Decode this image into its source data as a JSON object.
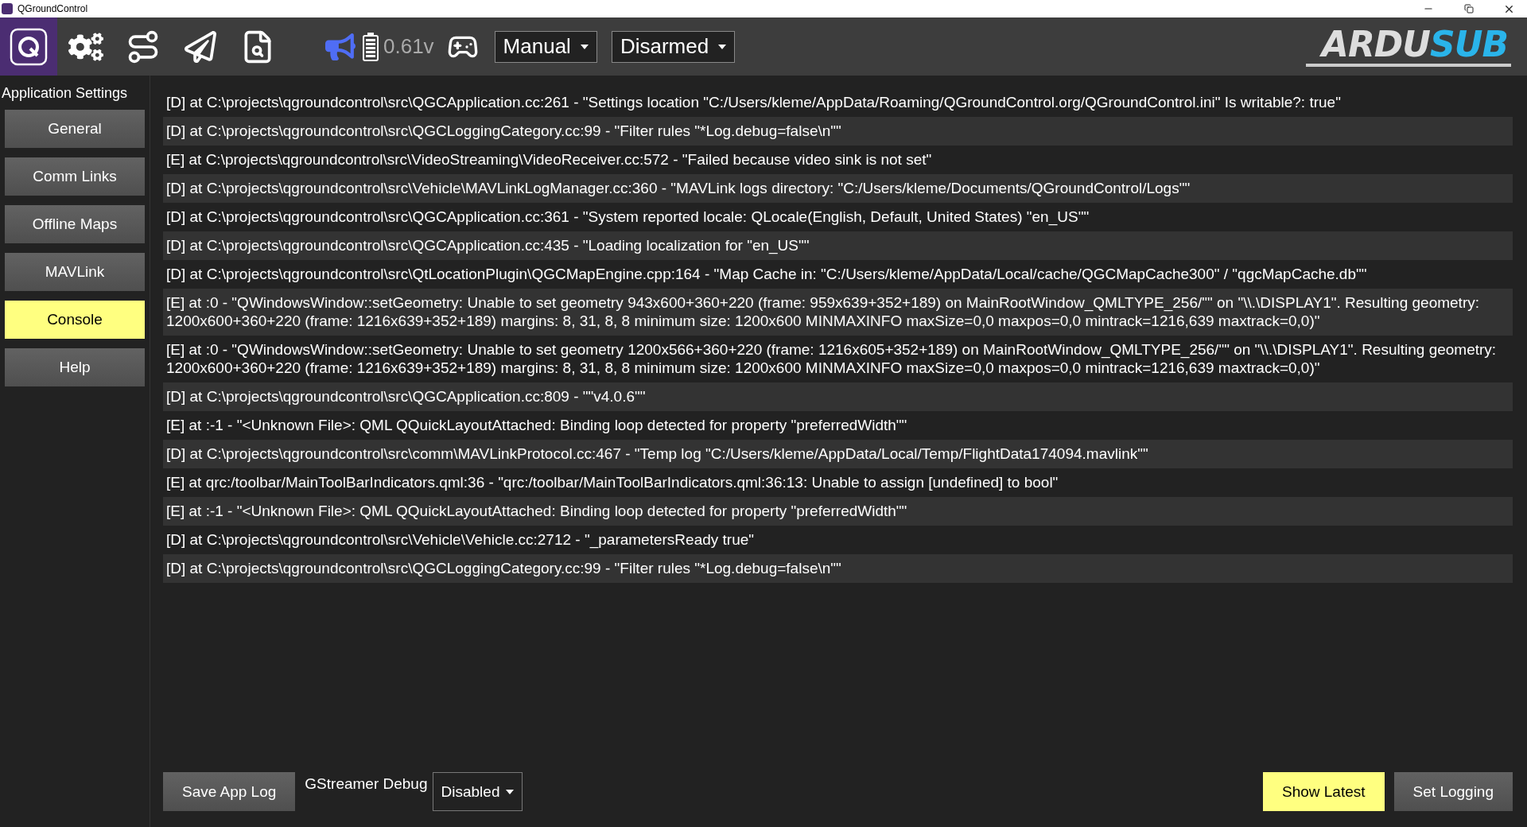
{
  "window": {
    "title": "QGroundControl"
  },
  "toolbar": {
    "battery_reading": "0.61v",
    "flight_mode": "Manual",
    "arm_state": "Disarmed",
    "logo": {
      "first": "ARDU",
      "second": "SUB"
    }
  },
  "sidebar": {
    "title": "Application Settings",
    "items": [
      {
        "label": "General",
        "selected": false
      },
      {
        "label": "Comm Links",
        "selected": false
      },
      {
        "label": "Offline Maps",
        "selected": false
      },
      {
        "label": "MAVLink",
        "selected": false
      },
      {
        "label": "Console",
        "selected": true
      },
      {
        "label": "Help",
        "selected": false
      }
    ]
  },
  "console": {
    "lines": [
      "[D] at C:\\projects\\qgroundcontrol\\src\\QGCApplication.cc:261 - \"Settings location \"C:/Users/kleme/AppData/Roaming/QGroundControl.org/QGroundControl.ini\" Is writable?: true\"",
      "[D] at C:\\projects\\qgroundcontrol\\src\\QGCLoggingCategory.cc:99 - \"Filter rules \"*Log.debug=false\\n\"\"",
      "[E] at C:\\projects\\qgroundcontrol\\src\\VideoStreaming\\VideoReceiver.cc:572 - \"Failed because video sink is not set\"",
      "[D] at C:\\projects\\qgroundcontrol\\src\\Vehicle\\MAVLinkLogManager.cc:360 - \"MAVLink logs directory: \"C:/Users/kleme/Documents/QGroundControl/Logs\"\"",
      "[D] at C:\\projects\\qgroundcontrol\\src\\QGCApplication.cc:361 - \"System reported locale: QLocale(English, Default, United States) \"en_US\"\"",
      "[D] at C:\\projects\\qgroundcontrol\\src\\QGCApplication.cc:435 - \"Loading localization for \"en_US\"\"",
      "[D] at C:\\projects\\qgroundcontrol\\src\\QtLocationPlugin\\QGCMapEngine.cpp:164 - \"Map Cache in: \"C:/Users/kleme/AppData/Local/cache/QGCMapCache300\" / \"qgcMapCache.db\"\"",
      "[E] at :0 - \"QWindowsWindow::setGeometry: Unable to set geometry 943x600+360+220 (frame: 959x639+352+189) on MainRootWindow_QMLTYPE_256/\"\" on \"\\\\.\\DISPLAY1\". Resulting geometry: 1200x600+360+220 (frame: 1216x639+352+189) margins: 8, 31, 8, 8 minimum size: 1200x600 MINMAXINFO maxSize=0,0 maxpos=0,0 mintrack=1216,639 maxtrack=0,0)\"",
      "[E] at :0 - \"QWindowsWindow::setGeometry: Unable to set geometry 1200x566+360+220 (frame: 1216x605+352+189) on MainRootWindow_QMLTYPE_256/\"\" on \"\\\\.\\DISPLAY1\". Resulting geometry: 1200x600+360+220 (frame: 1216x639+352+189) margins: 8, 31, 8, 8 minimum size: 1200x600 MINMAXINFO maxSize=0,0 maxpos=0,0 mintrack=1216,639 maxtrack=0,0)\"",
      "[D] at C:\\projects\\qgroundcontrol\\src\\QGCApplication.cc:809 - \"\"v4.0.6\"\"",
      "[E] at :-1 - \"<Unknown File>: QML QQuickLayoutAttached: Binding loop detected for property \"preferredWidth\"\"",
      "[D] at C:\\projects\\qgroundcontrol\\src\\comm\\MAVLinkProtocol.cc:467 - \"Temp log \"C:/Users/kleme/AppData/Local/Temp/FlightData174094.mavlink\"\"",
      "[E] at qrc:/toolbar/MainToolBarIndicators.qml:36 - \"qrc:/toolbar/MainToolBarIndicators.qml:36:13: Unable to assign [undefined] to bool\"",
      "[E] at :-1 - \"<Unknown File>: QML QQuickLayoutAttached: Binding loop detected for property \"preferredWidth\"\"",
      "[D] at C:\\projects\\qgroundcontrol\\src\\Vehicle\\Vehicle.cc:2712 - \"_parametersReady true\"",
      "[D] at C:\\projects\\qgroundcontrol\\src\\QGCLoggingCategory.cc:99 - \"Filter rules \"*Log.debug=false\\n\"\""
    ]
  },
  "bottom_bar": {
    "save_button": "Save App Log",
    "gstreamer_label": "GStreamer Debug",
    "gstreamer_value": "Disabled",
    "show_latest_button": "Show Latest",
    "set_logging_button": "Set Logging"
  }
}
